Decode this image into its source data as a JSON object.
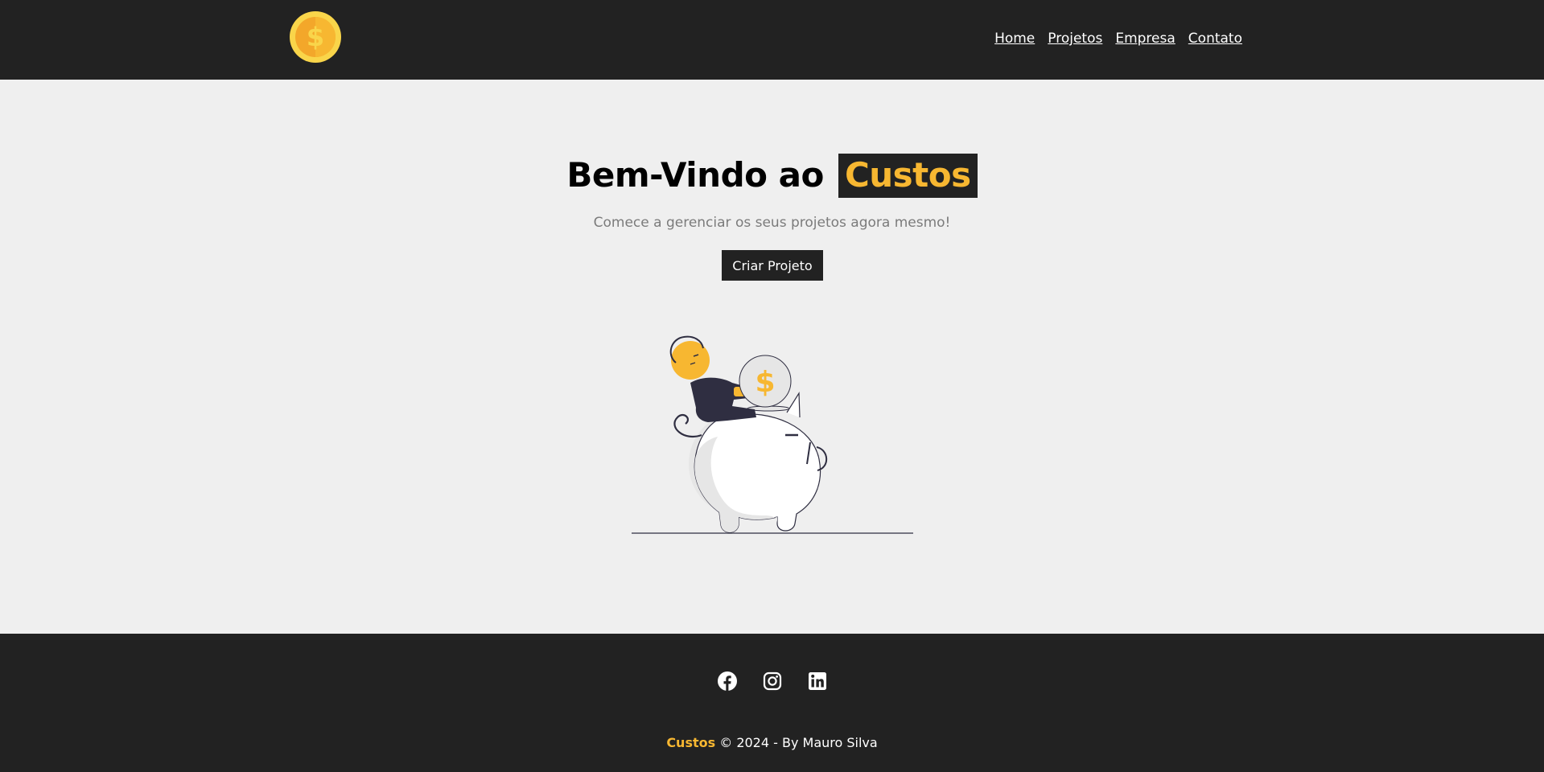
{
  "header": {
    "logo_icon": "dollar-coin-icon",
    "nav": [
      {
        "label": "Home"
      },
      {
        "label": "Projetos"
      },
      {
        "label": "Empresa"
      },
      {
        "label": "Contato"
      }
    ]
  },
  "hero": {
    "title_prefix": "Bem-Vindo ao",
    "title_brand": "Custos",
    "subtitle": "Comece a gerenciar os seus projetos agora mesmo!",
    "cta_label": "Criar Projeto",
    "illustration_icon": "piggy-bank-savings-illustration",
    "coin_symbol": "$"
  },
  "footer": {
    "socials": [
      {
        "icon": "facebook-icon"
      },
      {
        "icon": "instagram-icon"
      },
      {
        "icon": "linkedin-icon"
      }
    ],
    "brand": "Custos",
    "copyright": "© 2024 - By Mauro Silva"
  },
  "colors": {
    "dark": "#222222",
    "accent": "#f7b731",
    "background": "#efefef",
    "muted_text": "#7b7b7b"
  }
}
